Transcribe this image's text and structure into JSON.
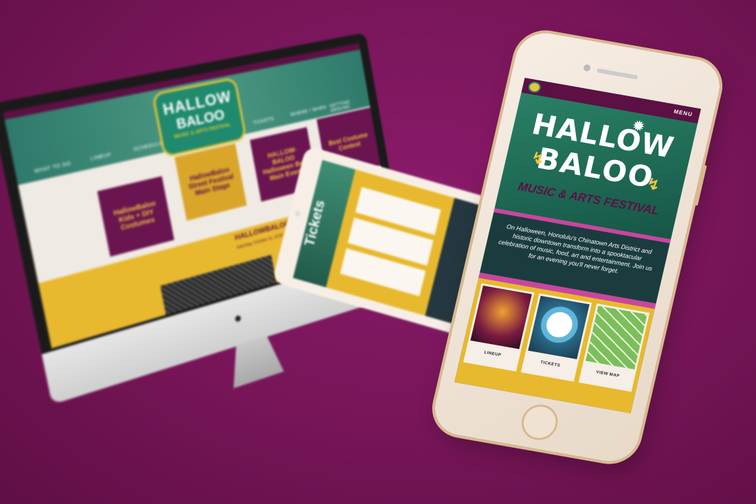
{
  "colors": {
    "background": "#761557",
    "brand_purple": "#5c1044",
    "brand_green": "#1f8a6d",
    "brand_gold": "#e8b92e",
    "accent_pink": "#c9469f"
  },
  "phone": {
    "menu_label": "MENU",
    "logo_icon": "hallowbaloo-badge-icon",
    "title_line1": "HALLOW",
    "title_line2": "BALOO",
    "subtitle": "MUSIC & ARTS FESTIVAL",
    "about": "On Halloween, Honolulu's Chinatown Arts District and historic downtown transform into a spooktacular celebration of music, food, art and entertainment. Join us for an evening you'll never forget.",
    "cards": [
      {
        "label": "LINEUP",
        "image": "stage-photo"
      },
      {
        "label": "TICKETS",
        "image": "mascot-photo"
      },
      {
        "label": "VIEW MAP",
        "image": "festival-map"
      }
    ]
  },
  "tablet": {
    "title": "Tickets"
  },
  "desktop": {
    "logo_line1": "HALLOW",
    "logo_line2": "BALOO",
    "logo_tagline": "MUSIC & ARTS FESTIVAL",
    "nav": [
      "WHAT TO DO",
      "LINEUP",
      "SCHEDULE",
      "TICKETS",
      "WHERE / WHEN",
      "GETTING AROUND"
    ],
    "tiles": [
      "HallowBaloo Kids + DIY Costumes",
      "HallowBaloo Street Festival Main Stage",
      "HALLOW-BALOO Halloween Ball Main Event",
      "Best Costume Contest"
    ],
    "banner_title": "HALLOWBALOO STREET FESTIVAL",
    "banner_sub": "Saturday, October 31, 2015 • 4:00pm — Midnight"
  }
}
